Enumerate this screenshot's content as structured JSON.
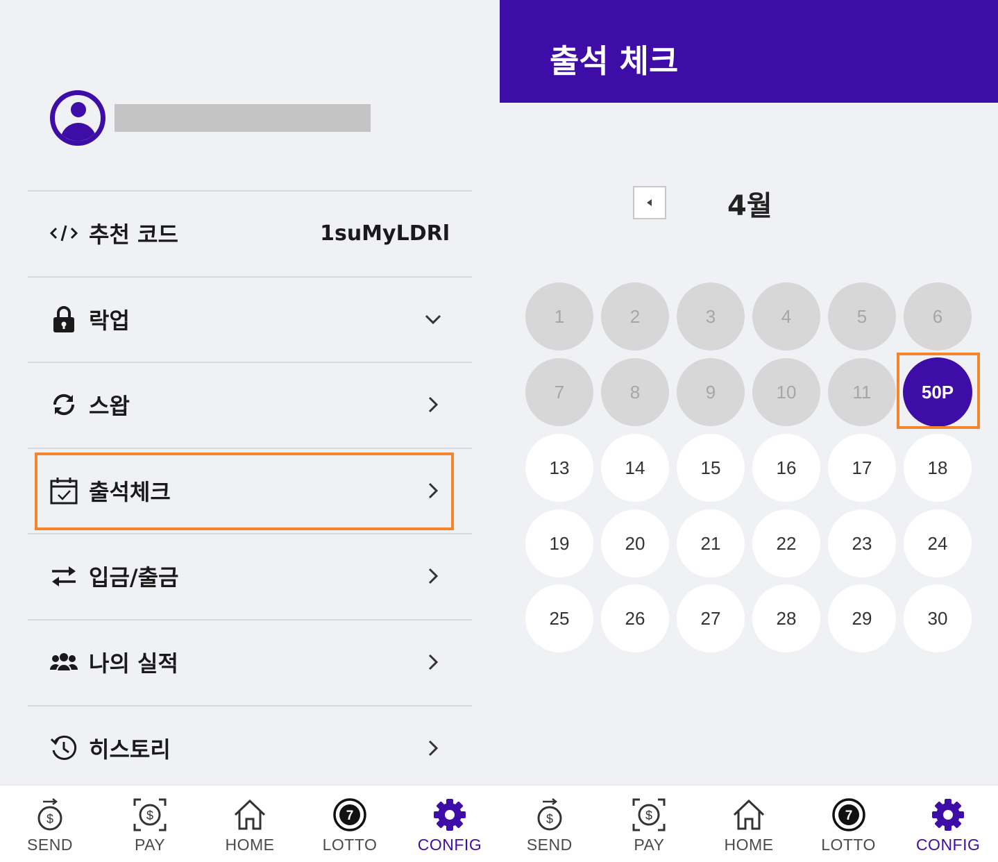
{
  "left": {
    "menu": [
      {
        "label": "추천 코드",
        "value": "1suMyLDRl",
        "icon": "code-icon"
      },
      {
        "label": "락업",
        "icon": "lock-icon",
        "chevron": "chevron-down-icon"
      },
      {
        "label": "스왑",
        "icon": "swap-icon",
        "chevron": "chevron-right-icon"
      },
      {
        "label": "출석체크",
        "icon": "calendar-check-icon",
        "chevron": "chevron-right-icon",
        "highlighted": true
      },
      {
        "label": "입금/출금",
        "icon": "transfer-icon",
        "chevron": "chevron-right-icon"
      },
      {
        "label": "나의 실적",
        "icon": "group-icon",
        "chevron": "chevron-right-icon"
      },
      {
        "label": "히스토리",
        "icon": "history-icon",
        "chevron": "chevron-right-icon"
      }
    ]
  },
  "right": {
    "title": "출석 체크",
    "month": "4월",
    "days": [
      {
        "label": "1",
        "state": "past"
      },
      {
        "label": "2",
        "state": "past"
      },
      {
        "label": "3",
        "state": "past"
      },
      {
        "label": "4",
        "state": "past"
      },
      {
        "label": "5",
        "state": "past"
      },
      {
        "label": "6",
        "state": "past"
      },
      {
        "label": "7",
        "state": "past"
      },
      {
        "label": "8",
        "state": "past"
      },
      {
        "label": "9",
        "state": "past"
      },
      {
        "label": "10",
        "state": "past"
      },
      {
        "label": "11",
        "state": "past"
      },
      {
        "label": "50P",
        "state": "today"
      },
      {
        "label": "13",
        "state": "future"
      },
      {
        "label": "14",
        "state": "future"
      },
      {
        "label": "15",
        "state": "future"
      },
      {
        "label": "16",
        "state": "future"
      },
      {
        "label": "17",
        "state": "future"
      },
      {
        "label": "18",
        "state": "future"
      },
      {
        "label": "19",
        "state": "future"
      },
      {
        "label": "20",
        "state": "future"
      },
      {
        "label": "21",
        "state": "future"
      },
      {
        "label": "22",
        "state": "future"
      },
      {
        "label": "23",
        "state": "future"
      },
      {
        "label": "24",
        "state": "future"
      },
      {
        "label": "25",
        "state": "future"
      },
      {
        "label": "26",
        "state": "future"
      },
      {
        "label": "27",
        "state": "future"
      },
      {
        "label": "28",
        "state": "future"
      },
      {
        "label": "29",
        "state": "future"
      },
      {
        "label": "30",
        "state": "future"
      }
    ]
  },
  "nav": {
    "items": [
      {
        "label": "SEND",
        "icon": "send-money-icon"
      },
      {
        "label": "PAY",
        "icon": "pay-scan-icon"
      },
      {
        "label": "HOME",
        "icon": "home-icon"
      },
      {
        "label": "LOTTO",
        "icon": "lotto-ball-icon"
      },
      {
        "label": "CONFIG",
        "icon": "gear-icon",
        "active": true
      }
    ]
  },
  "colors": {
    "brand": "#3e0ca7",
    "highlight": "#f5852d",
    "past_day": "#d7d7d7"
  }
}
